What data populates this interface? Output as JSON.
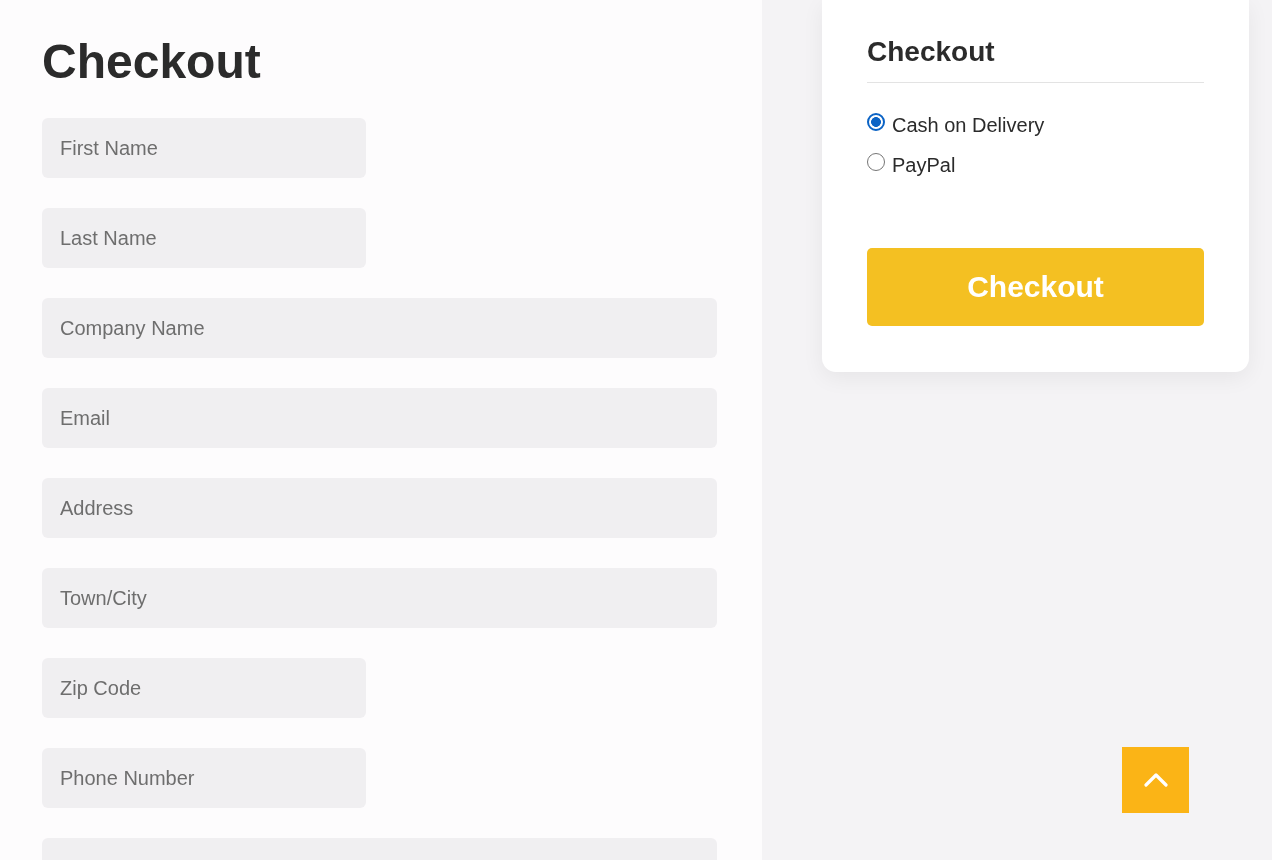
{
  "checkout_form": {
    "title": "Checkout",
    "fields": [
      {
        "kind": "short",
        "placeholder": "First Name"
      },
      {
        "kind": "short",
        "placeholder": "Last Name"
      },
      {
        "kind": "long",
        "placeholder": "Company Name"
      },
      {
        "kind": "long",
        "placeholder": "Email"
      },
      {
        "kind": "long",
        "placeholder": "Address"
      },
      {
        "kind": "long",
        "placeholder": "Town/City"
      },
      {
        "kind": "short",
        "placeholder": "Zip Code"
      },
      {
        "kind": "short",
        "placeholder": "Phone Number"
      },
      {
        "kind": "long"
      }
    ]
  },
  "order_panel": {
    "title": "Checkout",
    "payment_options": [
      {
        "label": "Cash on Delivery",
        "selected": true
      },
      {
        "label": "PayPal",
        "selected": false
      }
    ],
    "submit_button": "Checkout"
  }
}
